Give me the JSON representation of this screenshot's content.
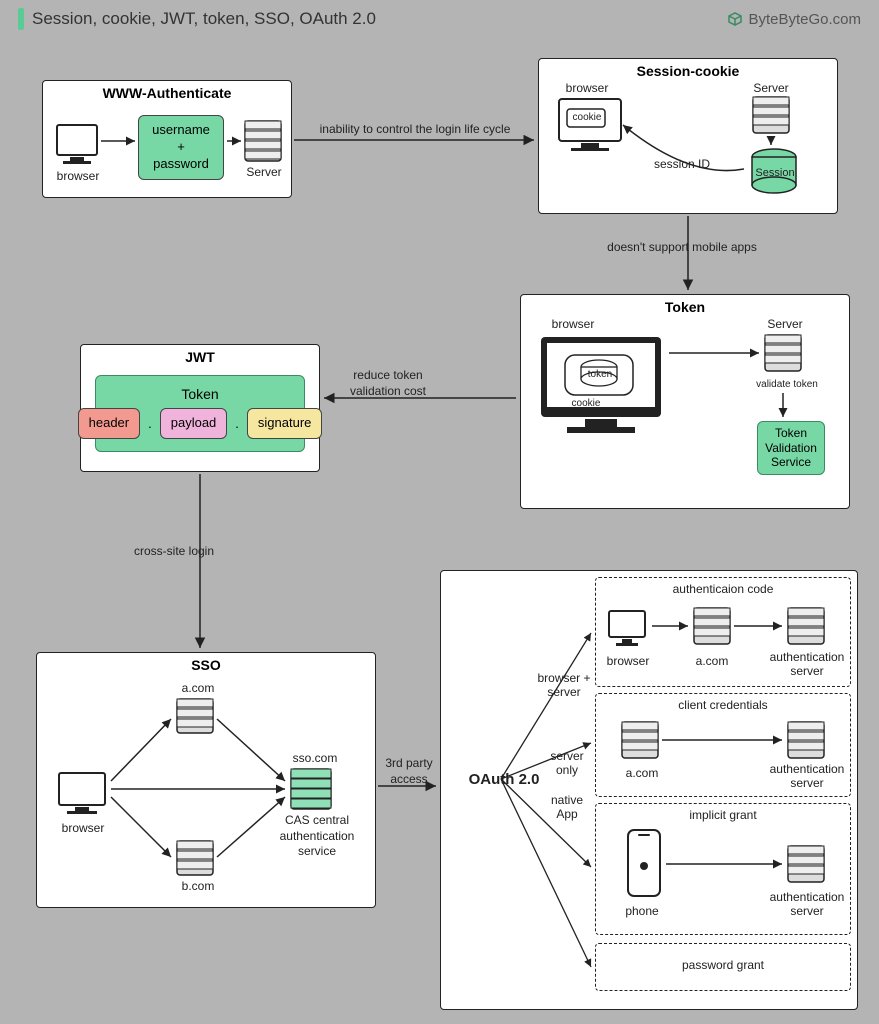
{
  "page": {
    "title": "Session, cookie, JWT, token, SSO, OAuth 2.0",
    "brand": "ByteByteGo.com"
  },
  "arrows": {
    "inability": "inability to control the login life cycle",
    "mobile": "doesn't support mobile apps",
    "reduce_cost": "reduce token validation cost",
    "cross_site": "cross-site login",
    "third_party": "3rd party access",
    "browser_server": "browser + server",
    "server_only": "server only",
    "native_app": "native App"
  },
  "www_auth": {
    "title": "WWW-Authenticate",
    "browser": "browser",
    "credentials": "username + password",
    "server": "Server"
  },
  "session_cookie": {
    "title": "Session-cookie",
    "browser": "browser",
    "cookie": "cookie",
    "server": "Server",
    "session_id": "session ID",
    "session_db": "Session"
  },
  "token": {
    "title": "Token",
    "browser": "browser",
    "token_label": "token",
    "cookie": "cookie",
    "server": "Server",
    "validate": "validate token",
    "svc": "Token Validation Service"
  },
  "jwt": {
    "title": "JWT",
    "token_label": "Token",
    "header": "header",
    "payload": "payload",
    "signature": "signature"
  },
  "sso": {
    "title": "SSO",
    "browser": "browser",
    "a": "a.com",
    "b": "b.com",
    "sso_label": "sso.com",
    "cas": "CAS central authentication service"
  },
  "oauth": {
    "title": "OAuth 2.0",
    "auth_code_title": "authenticaion code",
    "client_cred_title": "client credentials",
    "implicit_title": "implicit grant",
    "password_title": "password grant",
    "browser": "browser",
    "a": "a.com",
    "auth_server": "authentication server",
    "phone": "phone"
  }
}
